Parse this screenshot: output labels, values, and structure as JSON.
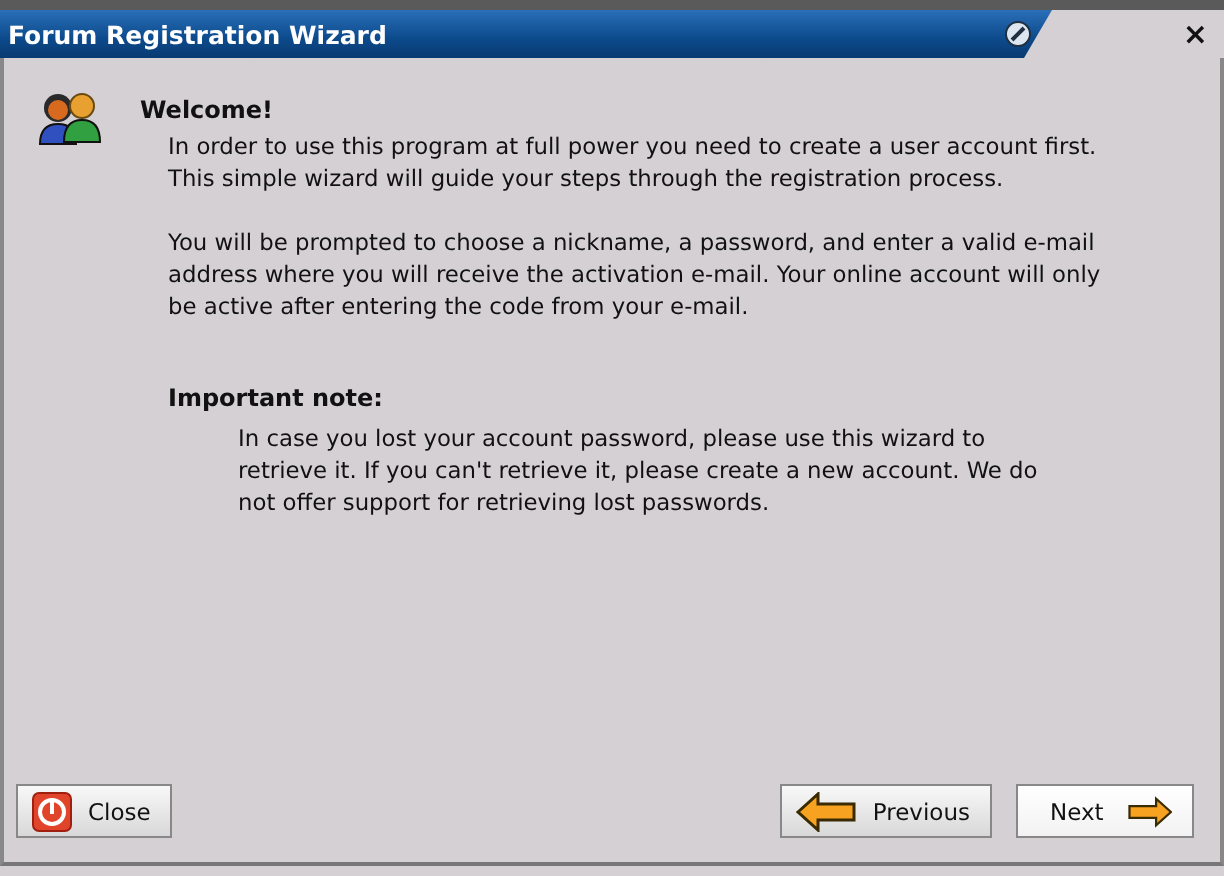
{
  "window": {
    "title": "Forum Registration Wizard",
    "close": "×"
  },
  "welcome": {
    "heading": "Welcome!",
    "paragraphs": [
      "In order to use this program at full power you need to create a user account first. This simple wizard will guide your steps through the registration process.",
      "You will be prompted to choose a nickname, a password, and enter a valid e-mail address where you will receive the activation e-mail. Your online account will only be active after entering the code from your e-mail."
    ]
  },
  "note": {
    "heading": "Important note:",
    "text": "In case you lost your account password, please use this wizard to retrieve it. If you can't retrieve it, please create a new account. We do not offer support for retrieving lost passwords."
  },
  "buttons": [
    {
      "kind": "close",
      "label": "Close"
    },
    {
      "kind": "previous",
      "label": "Previous"
    },
    {
      "kind": "next",
      "label": "Next"
    }
  ]
}
